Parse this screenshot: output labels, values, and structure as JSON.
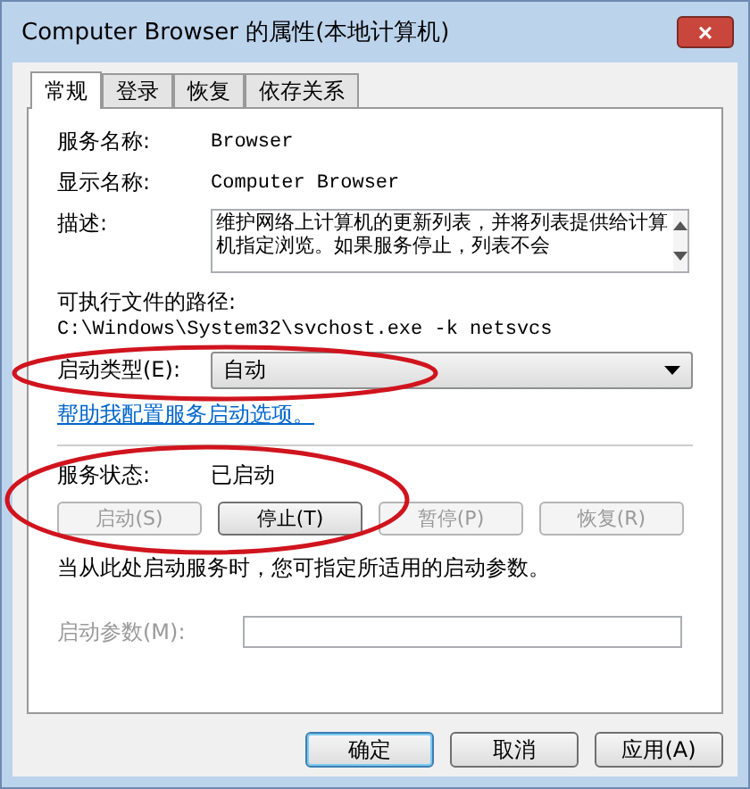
{
  "window": {
    "title": "Computer Browser 的属性(本地计算机)",
    "close": "×"
  },
  "tabs": [
    {
      "label": "常规",
      "selected": true
    },
    {
      "label": "登录",
      "selected": false
    },
    {
      "label": "恢复",
      "selected": false
    },
    {
      "label": "依存关系",
      "selected": false
    }
  ],
  "fields": [
    {
      "label": "服务名称:",
      "value": "Browser"
    },
    {
      "label": "显示名称:",
      "value": "Computer Browser"
    }
  ],
  "description": {
    "label": "描述:",
    "value": "维护网络上计算机的更新列表，并将列表提供给计算机指定浏览。如果服务停止，列表不会"
  },
  "path": {
    "label": "可执行文件的路径:",
    "value": "C:\\Windows\\System32\\svchost.exe -k netsvcs"
  },
  "startup_type": {
    "label": "启动类型(E):",
    "value": "自动"
  },
  "help_link": "帮助我配置服务启动选项。",
  "service_status": {
    "label": "服务状态:",
    "value": "已启动"
  },
  "service_buttons": [
    {
      "label": "启动(S)",
      "disabled": true
    },
    {
      "label": "停止(T)",
      "disabled": false
    },
    {
      "label": "暂停(P)",
      "disabled": true
    },
    {
      "label": "恢复(R)",
      "disabled": true
    }
  ],
  "note": "当从此处启动服务时，您可指定所适用的启动参数。",
  "start_params": {
    "label": "启动参数(M):",
    "disabled": true
  },
  "dialog_buttons": [
    {
      "label": "确定",
      "selected": true
    },
    {
      "label": "取消",
      "selected": false
    },
    {
      "label": "应用(A)",
      "selected": false
    }
  ]
}
